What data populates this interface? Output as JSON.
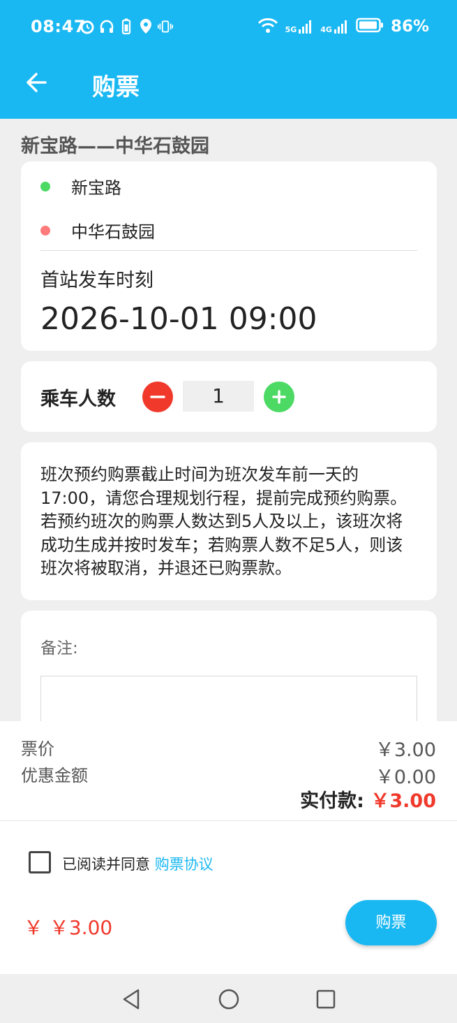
{
  "status_bar": {
    "time": "08:47",
    "battery": "86%",
    "net1": "5G",
    "net2": "4G",
    "icons": [
      "alarm-icon",
      "headset-icon",
      "battery-saver-icon",
      "location-icon",
      "vibrate-icon",
      "wifi-icon",
      "signal-icon",
      "battery-icon"
    ]
  },
  "header": {
    "title": "购票",
    "back_icon": "back-arrow-icon"
  },
  "route": {
    "title": "新宝路——中华石鼓园"
  },
  "stations": [
    {
      "name": "新宝路",
      "color": "#4cd964"
    },
    {
      "name": "中华石鼓园",
      "color": "#ff7b7b"
    }
  ],
  "departure": {
    "label": "首站发车时刻",
    "time": "2026-10-01 09:00"
  },
  "passengers": {
    "label": "乘车人数",
    "count": "1"
  },
  "notice": "班次预约购票截止时间为班次发车前一天的17:00，请您合理规划行程，提前完成预约购票。若预约班次的购票人数达到5人及以上，该班次将成功生成并按时发车；若购票人数不足5人，则该班次将被取消，并退还已购票款。",
  "remark": {
    "label": "备注:",
    "value": ""
  },
  "pricing": {
    "ticket_label": "票价",
    "ticket_value": "￥3.00",
    "discount_label": "优惠金额",
    "discount_value": "￥0.00",
    "paid_label": "实付款:",
    "paid_value": "￥3.00"
  },
  "agreement": {
    "text": "已阅读并同意",
    "link": "购票协议",
    "checked": false
  },
  "footer": {
    "total": "￥ ￥3.00",
    "buy_label": "购票"
  },
  "colors": {
    "accent": "#1ab8f2",
    "price_red": "#f0392b",
    "green": "#4cd964"
  }
}
